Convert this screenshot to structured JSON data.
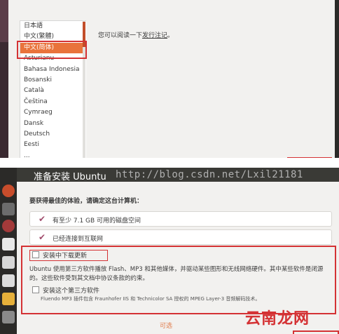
{
  "top_panel": {
    "languages": [
      "日本語",
      "中文(繁體)",
      "中文(简体)",
      "Asturianu",
      "Bahasa Indonesia",
      "Bosanski",
      "Català",
      "Čeština",
      "Cymraeg",
      "Dansk",
      "Deutsch",
      "Eesti",
      "..."
    ],
    "selected_index": 2,
    "notes_prefix": "您可以阅读一下",
    "notes_link": "发行注记",
    "notes_suffix": "。"
  },
  "bottom_panel": {
    "window_title": "准备安装 Ubuntu",
    "watermark": "http://blog.csdn.net/Lxil21181",
    "requirements_title": "要获得最佳的体验，请确定这台计算机：",
    "requirements": [
      {
        "label": "有至少 7.1 GB 可用的磁盘空间"
      },
      {
        "label": "已经连接到互联网"
      }
    ],
    "download_updates_label": "安装中下载更新",
    "description": "Ubuntu 使用第三方软件播放 Flash、MP3 和其他媒体，并驱动某些图形和无线网络硬件。其中某些软件是闭源的。这些软件受到其文档中协议条款的约束。",
    "third_party_label": "安装这个第三方软件",
    "third_party_note": "Fluendo MP3 插件包含 Fraunhofer IIS 和 Technicolor SA 授权的 MPEG Layer-3 音频解码技术。",
    "optional_label": "可选",
    "site_mark": "云南龙网"
  },
  "colors": {
    "accent": "#e9733b",
    "highlight_red": "#d43234",
    "launcher": "#2b2a28"
  }
}
